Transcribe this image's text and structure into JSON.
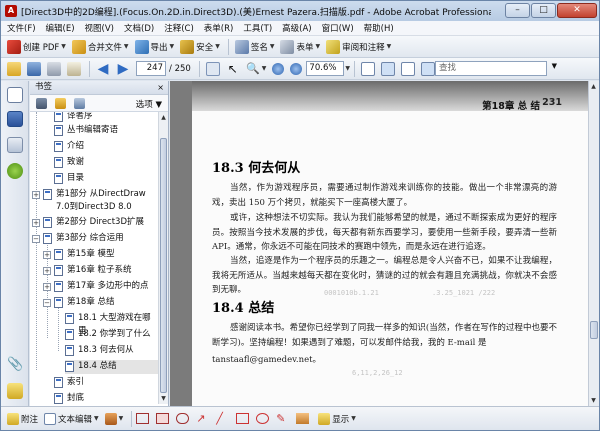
{
  "window": {
    "title": "[Direct3D中的2D编程].(Focus.On.2D.in.Direct3D).(美)Ernest Pazera.扫描版.pdf - Adobe Acrobat Professional",
    "app_icon": "acrobat-icon",
    "controls": {
      "minimize": "–",
      "maximize": "□",
      "close": "✕"
    }
  },
  "menu": [
    "文件(F)",
    "编辑(E)",
    "视图(V)",
    "文档(D)",
    "注释(C)",
    "表单(R)",
    "工具(T)",
    "高级(A)",
    "窗口(W)",
    "帮助(H)"
  ],
  "toolbar1": {
    "create_pdf": "创建 PDF",
    "combine": "合并文件",
    "export": "导出",
    "secure": "安全",
    "sign": "签名",
    "forms": "表单",
    "review": "审阅和注释"
  },
  "toolbar2": {
    "page_current": "247",
    "page_total": "/ 250",
    "zoom": "70.6%",
    "find_placeholder": "查找"
  },
  "bookmarks": {
    "panel_title": "书签",
    "close_label": "×",
    "options_label": "选项",
    "items": [
      {
        "label": "译者序",
        "expander": ""
      },
      {
        "label": "丛书编辑寄语",
        "expander": ""
      },
      {
        "label": "介绍",
        "expander": ""
      },
      {
        "label": "致谢",
        "expander": ""
      },
      {
        "label": "目录",
        "expander": ""
      },
      {
        "label": "第1部分 从DirectDraw 7.0到Direct3D 8.0",
        "expander": "+"
      },
      {
        "label": "第2部分 Direct3D扩展",
        "expander": "+"
      },
      {
        "label": "第3部分 综合运用",
        "expander": "−"
      },
      {
        "label": "第15章 模型",
        "expander": "+"
      },
      {
        "label": "第16章 粒子系统",
        "expander": "+"
      },
      {
        "label": "第17章 多边形中的点",
        "expander": "+"
      },
      {
        "label": "第18章 总结",
        "expander": "−"
      },
      {
        "label": "18.1 大型游戏在哪里",
        "expander": ""
      },
      {
        "label": "18.2 你学到了什么",
        "expander": ""
      },
      {
        "label": "18.3 何去何从",
        "expander": ""
      },
      {
        "label": "18.4 总结",
        "expander": ""
      },
      {
        "label": "索引",
        "expander": ""
      },
      {
        "label": "封底",
        "expander": ""
      }
    ]
  },
  "document": {
    "running_head": "第18章  总  结",
    "page_number": "231",
    "section1_title": "18.3   何去何从",
    "section1_para1": "当然，作为游戏程序员，需要通过制作游戏来训练你的技能。做出一个非常漂亮的游戏，卖出 150 万个拷贝，就能买下一座高楼大厦了。",
    "section1_para2": "或许，这种想法不切实际。我认为我们能够希望的就是，通过不断探索成为更好的程序员。按照当今技术发展的步伐，每天都有新东西要学习，要使用一些新手段，要弄清一些新API。通常，你永远不可能在同技术的赛跑中领先，而是永远在进行追逐。",
    "section1_para3": "当然，追逐是作为一个程序员的乐趣之一。编程总是令人兴奋不已，如果不让我编程，我将无所适从。当越来越每天都在变化时，猜谜的过的就会有趣且充满挑战，你就决不会感到无聊。",
    "section2_title": "18.4   总结",
    "section2_para1": "感谢阅读本书。希望你已经学到了同我一样多的知识(当然，作者在写作的过程中也要不断学习)。坚持编程！如果遇到了难题，可以发邮件给我，我的 E-mail 是",
    "email": "tanstaafl@gamedev.net。",
    "ghost_text": [
      "0001010b.1.21",
      ".3.25_1021 /222",
      "6,11,2,26_12"
    ]
  },
  "bottom_toolbar": {
    "attach": "附注",
    "text_edit": "文本编辑",
    "show": "显示"
  }
}
